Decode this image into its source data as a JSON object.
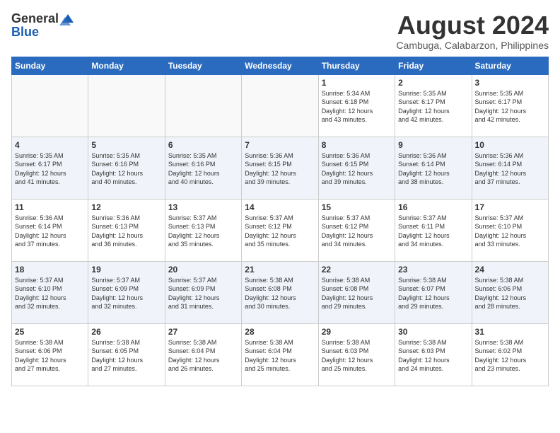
{
  "logo": {
    "general": "General",
    "blue": "Blue"
  },
  "title": "August 2024",
  "location": "Cambuga, Calabarzon, Philippines",
  "days_header": [
    "Sunday",
    "Monday",
    "Tuesday",
    "Wednesday",
    "Thursday",
    "Friday",
    "Saturday"
  ],
  "weeks": [
    [
      {
        "day": "",
        "text": ""
      },
      {
        "day": "",
        "text": ""
      },
      {
        "day": "",
        "text": ""
      },
      {
        "day": "",
        "text": ""
      },
      {
        "day": "1",
        "text": "Sunrise: 5:34 AM\nSunset: 6:18 PM\nDaylight: 12 hours\nand 43 minutes."
      },
      {
        "day": "2",
        "text": "Sunrise: 5:35 AM\nSunset: 6:17 PM\nDaylight: 12 hours\nand 42 minutes."
      },
      {
        "day": "3",
        "text": "Sunrise: 5:35 AM\nSunset: 6:17 PM\nDaylight: 12 hours\nand 42 minutes."
      }
    ],
    [
      {
        "day": "4",
        "text": "Sunrise: 5:35 AM\nSunset: 6:17 PM\nDaylight: 12 hours\nand 41 minutes."
      },
      {
        "day": "5",
        "text": "Sunrise: 5:35 AM\nSunset: 6:16 PM\nDaylight: 12 hours\nand 40 minutes."
      },
      {
        "day": "6",
        "text": "Sunrise: 5:35 AM\nSunset: 6:16 PM\nDaylight: 12 hours\nand 40 minutes."
      },
      {
        "day": "7",
        "text": "Sunrise: 5:36 AM\nSunset: 6:15 PM\nDaylight: 12 hours\nand 39 minutes."
      },
      {
        "day": "8",
        "text": "Sunrise: 5:36 AM\nSunset: 6:15 PM\nDaylight: 12 hours\nand 39 minutes."
      },
      {
        "day": "9",
        "text": "Sunrise: 5:36 AM\nSunset: 6:14 PM\nDaylight: 12 hours\nand 38 minutes."
      },
      {
        "day": "10",
        "text": "Sunrise: 5:36 AM\nSunset: 6:14 PM\nDaylight: 12 hours\nand 37 minutes."
      }
    ],
    [
      {
        "day": "11",
        "text": "Sunrise: 5:36 AM\nSunset: 6:14 PM\nDaylight: 12 hours\nand 37 minutes."
      },
      {
        "day": "12",
        "text": "Sunrise: 5:36 AM\nSunset: 6:13 PM\nDaylight: 12 hours\nand 36 minutes."
      },
      {
        "day": "13",
        "text": "Sunrise: 5:37 AM\nSunset: 6:13 PM\nDaylight: 12 hours\nand 35 minutes."
      },
      {
        "day": "14",
        "text": "Sunrise: 5:37 AM\nSunset: 6:12 PM\nDaylight: 12 hours\nand 35 minutes."
      },
      {
        "day": "15",
        "text": "Sunrise: 5:37 AM\nSunset: 6:12 PM\nDaylight: 12 hours\nand 34 minutes."
      },
      {
        "day": "16",
        "text": "Sunrise: 5:37 AM\nSunset: 6:11 PM\nDaylight: 12 hours\nand 34 minutes."
      },
      {
        "day": "17",
        "text": "Sunrise: 5:37 AM\nSunset: 6:10 PM\nDaylight: 12 hours\nand 33 minutes."
      }
    ],
    [
      {
        "day": "18",
        "text": "Sunrise: 5:37 AM\nSunset: 6:10 PM\nDaylight: 12 hours\nand 32 minutes."
      },
      {
        "day": "19",
        "text": "Sunrise: 5:37 AM\nSunset: 6:09 PM\nDaylight: 12 hours\nand 32 minutes."
      },
      {
        "day": "20",
        "text": "Sunrise: 5:37 AM\nSunset: 6:09 PM\nDaylight: 12 hours\nand 31 minutes."
      },
      {
        "day": "21",
        "text": "Sunrise: 5:38 AM\nSunset: 6:08 PM\nDaylight: 12 hours\nand 30 minutes."
      },
      {
        "day": "22",
        "text": "Sunrise: 5:38 AM\nSunset: 6:08 PM\nDaylight: 12 hours\nand 29 minutes."
      },
      {
        "day": "23",
        "text": "Sunrise: 5:38 AM\nSunset: 6:07 PM\nDaylight: 12 hours\nand 29 minutes."
      },
      {
        "day": "24",
        "text": "Sunrise: 5:38 AM\nSunset: 6:06 PM\nDaylight: 12 hours\nand 28 minutes."
      }
    ],
    [
      {
        "day": "25",
        "text": "Sunrise: 5:38 AM\nSunset: 6:06 PM\nDaylight: 12 hours\nand 27 minutes."
      },
      {
        "day": "26",
        "text": "Sunrise: 5:38 AM\nSunset: 6:05 PM\nDaylight: 12 hours\nand 27 minutes."
      },
      {
        "day": "27",
        "text": "Sunrise: 5:38 AM\nSunset: 6:04 PM\nDaylight: 12 hours\nand 26 minutes."
      },
      {
        "day": "28",
        "text": "Sunrise: 5:38 AM\nSunset: 6:04 PM\nDaylight: 12 hours\nand 25 minutes."
      },
      {
        "day": "29",
        "text": "Sunrise: 5:38 AM\nSunset: 6:03 PM\nDaylight: 12 hours\nand 25 minutes."
      },
      {
        "day": "30",
        "text": "Sunrise: 5:38 AM\nSunset: 6:03 PM\nDaylight: 12 hours\nand 24 minutes."
      },
      {
        "day": "31",
        "text": "Sunrise: 5:38 AM\nSunset: 6:02 PM\nDaylight: 12 hours\nand 23 minutes."
      }
    ]
  ]
}
